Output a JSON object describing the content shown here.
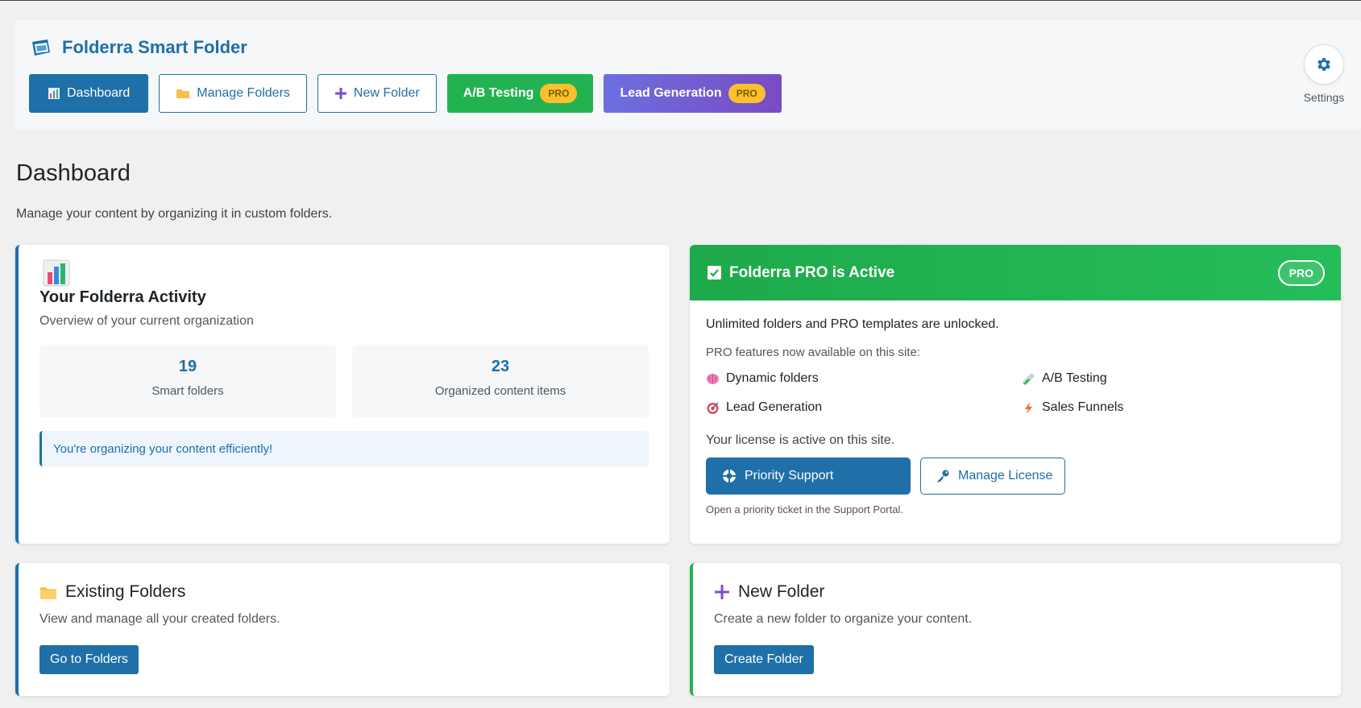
{
  "header": {
    "title": "Folderra Smart Folder",
    "nav": [
      {
        "label": "Dashboard",
        "icon": "bar-chart-icon"
      },
      {
        "label": "Manage Folders",
        "icon": "folder-icon"
      },
      {
        "label": "New Folder",
        "icon": "plus-icon"
      },
      {
        "label": "A/B Testing",
        "badge": "PRO"
      },
      {
        "label": "Lead Generation",
        "badge": "PRO"
      }
    ],
    "settings_label": "Settings"
  },
  "page": {
    "title": "Dashboard",
    "subtitle": "Manage your content by organizing it in custom folders."
  },
  "activity": {
    "title": "Your Folderra Activity",
    "subtitle": "Overview of your current organization",
    "stats": [
      {
        "value": "19",
        "label": "Smart folders"
      },
      {
        "value": "23",
        "label": "Organized content items"
      }
    ],
    "notice": "You're organizing your content efficiently!"
  },
  "pro": {
    "title": "Folderra PRO is Active",
    "badge": "PRO",
    "line1": "Unlimited folders and PRO templates are unlocked.",
    "line2": "PRO features now available on this site:",
    "features": [
      {
        "label": "Dynamic folders",
        "icon": "brain-icon"
      },
      {
        "label": "A/B Testing",
        "icon": "test-tube-icon"
      },
      {
        "label": "Lead Generation",
        "icon": "target-icon"
      },
      {
        "label": "Sales Funnels",
        "icon": "lightning-icon"
      }
    ],
    "license_text": "Your license is active on this site.",
    "support_button": "Priority Support",
    "license_button": "Manage License",
    "hint": "Open a priority ticket in the Support Portal."
  },
  "existing_folders": {
    "title": "Existing Folders",
    "subtitle": "View and manage all your created folders.",
    "button": "Go to Folders"
  },
  "new_folder": {
    "title": "New Folder",
    "subtitle": "Create a new folder to organize your content.",
    "button": "Create Folder"
  },
  "colors": {
    "primary": "#1f6fa8",
    "green": "#23b251",
    "purple": "#7a4bc3",
    "pro_badge": "#fbc02d"
  }
}
